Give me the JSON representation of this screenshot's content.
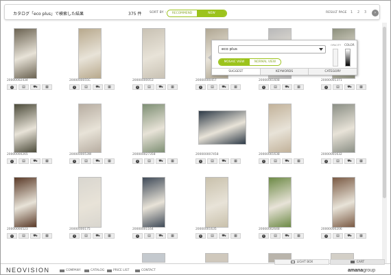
{
  "header": {
    "title": "カタログ「eco plus」で検索した結果",
    "count": "375 件",
    "sort_label": "SORT BY :",
    "sort_options": [
      "RECOMMEND",
      "NEW"
    ],
    "result_page_label": "RESULT PAGE",
    "pages": [
      "1",
      "2",
      "3"
    ],
    "next_icon": "chevron-right-icon"
  },
  "items": [
    {
      "code": "20000002434"
    },
    {
      "code": "2000000055C"
    },
    {
      "code": "20000000053"
    },
    {
      "code": "20000000457"
    },
    {
      "code": "20000001608"
    },
    {
      "code": "20000001371"
    },
    {
      "code": "20000000265"
    },
    {
      "code": "2000000053W"
    },
    {
      "code": "200000027358"
    },
    {
      "code": "200000007458"
    },
    {
      "code": "20000001638"
    },
    {
      "code": "20000001632"
    },
    {
      "code": "20000000523"
    },
    {
      "code": "20000000175"
    },
    {
      "code": "20000001164"
    },
    {
      "code": "20000001635"
    },
    {
      "code": "20000002648"
    },
    {
      "code": "20000000206"
    }
  ],
  "item_actions": [
    "info-icon",
    "lightbox-icon",
    "cart-icon",
    "compare-icon"
  ],
  "popup": {
    "select_value": "eco plus",
    "color_label": "COLOR",
    "opacity_label": "OPACITY",
    "view_options": [
      "MOSAIC VIEW",
      "NORMAL VIEW"
    ],
    "tabs": [
      "SUGGEST",
      "KEYWORDS",
      "CATEGORY"
    ]
  },
  "footer": {
    "logo": "NEOVISION",
    "links": [
      "COMPANY",
      "CATALOG",
      "PRICE LIST",
      "CONTACT"
    ],
    "lightbox_label": "LIGHT BOX",
    "cart_label": "CART",
    "brand_a": "amana",
    "brand_b": "group"
  },
  "colors": {
    "accent": "#9cc31c",
    "thumb_colors": [
      "#6b6352",
      "#b8a98d",
      "#c9c2b4",
      "#b0a793",
      "#b9b9ba",
      "#8c8f7c",
      "#4d4c3b",
      "#b7ada1",
      "#7e8f74",
      "#2e3a47",
      "#c2b29a",
      "#8b8f85",
      "#5a3a28",
      "#d9d6cf",
      "#3f4a58",
      "#c9c1ac",
      "#6d8a46",
      "#7a5a44"
    ]
  }
}
